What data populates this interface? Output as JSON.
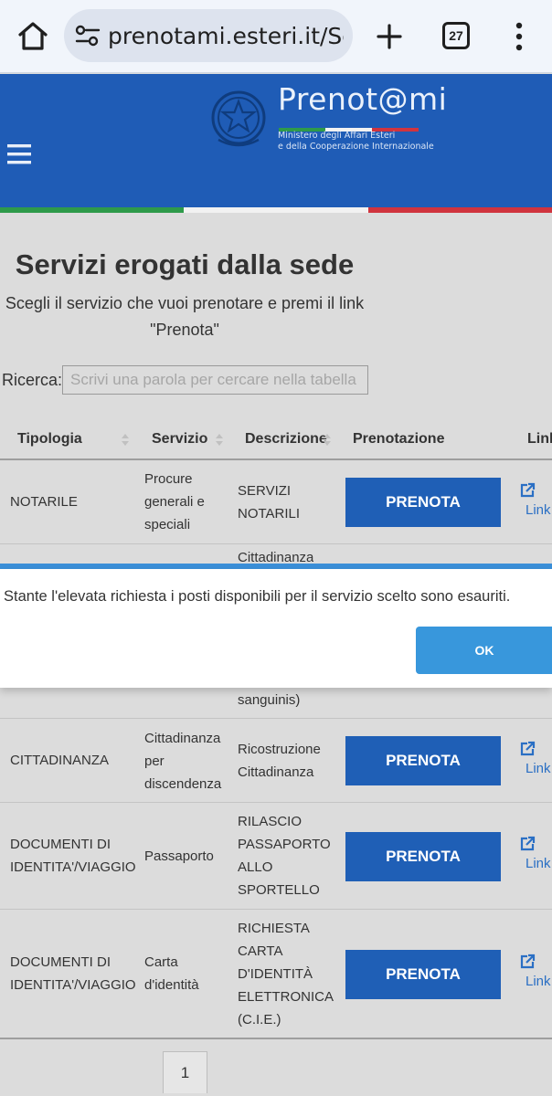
{
  "browser": {
    "url": "prenotami.esteri.it/Ser",
    "tab_count": "27"
  },
  "header": {
    "brand": "Prenot@mi",
    "ministry_line1": "Ministero degli Affari Esteri",
    "ministry_line2": "e della Cooperazione Internazionale",
    "colors": {
      "blue": "#1f5cb6",
      "green": "#2e9a4a",
      "white": "#f2f2f2",
      "red": "#d0343e"
    }
  },
  "main": {
    "title": "Servizi erogati dalla sede",
    "subtitle_line1": "Scegli il servizio che vuoi prenotare e premi il link",
    "subtitle_line2": "\"Prenota\"",
    "search_label": "Ricerca:",
    "search_placeholder": "Scrivi una parola per cercare nella tabella"
  },
  "table": {
    "headers": {
      "tipologia": "Tipologia",
      "servizio": "Servizio",
      "descrizione": "Descrizione",
      "prenotazione": "Prenotazione",
      "link": "Link"
    },
    "button_label": "PRENOTA",
    "link_label": "Link",
    "rows": [
      {
        "tipologia": [
          "NOTARILE"
        ],
        "servizio": [
          "Procure",
          "generali e",
          "speciali"
        ],
        "descrizione": [
          "SERVIZI",
          "NOTARILI"
        ]
      },
      {
        "tipologia": [],
        "servizio": [],
        "descrizione": [
          "Cittadinanza",
          "sanguinis)"
        ]
      },
      {
        "tipologia": [
          "CITTADINANZA"
        ],
        "servizio": [
          "Cittadinanza",
          "per",
          "discendenza"
        ],
        "descrizione": [
          "Ricostruzione",
          "Cittadinanza"
        ]
      },
      {
        "tipologia": [
          "DOCUMENTI DI",
          "IDENTITA'/VIAGGIO"
        ],
        "servizio": [
          "Passaporto"
        ],
        "descrizione": [
          "RILASCIO",
          "PASSAPORTO",
          "ALLO",
          "SPORTELLO"
        ]
      },
      {
        "tipologia": [
          "DOCUMENTI DI",
          "IDENTITA'/VIAGGIO"
        ],
        "servizio": [
          "Carta",
          "d'identità"
        ],
        "descrizione": [
          "RICHIESTA",
          "CARTA",
          "D'IDENTITÀ",
          "ELETTRONICA",
          "(C.I.E.)"
        ]
      }
    ]
  },
  "dialog": {
    "message": "Stante l'elevata richiesta i posti disponibili per il servizio scelto sono esauriti.",
    "ok_label": "OK"
  },
  "pagination": {
    "current_page": "1"
  }
}
